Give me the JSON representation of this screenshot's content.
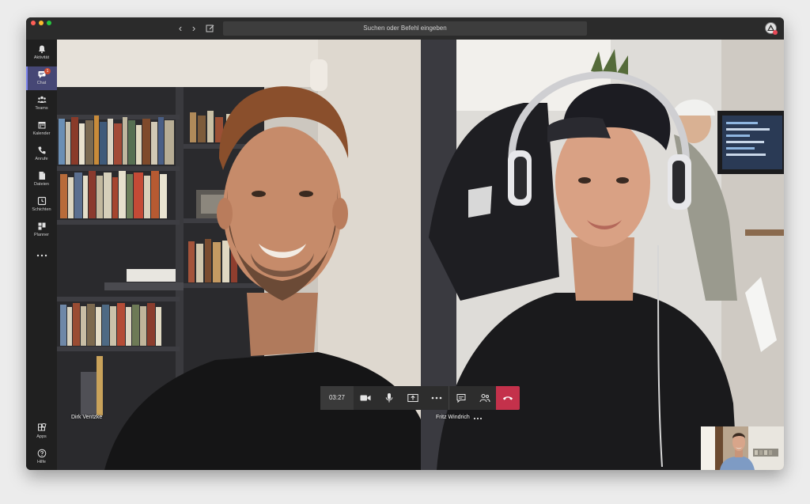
{
  "titlebar": {
    "search_placeholder": "Suchen oder Befehl eingeben",
    "back_icon": "chevron-left-icon",
    "forward_icon": "chevron-right-icon",
    "compose_icon": "compose-icon"
  },
  "rail": {
    "items": [
      {
        "label": "Aktivität",
        "icon": "bell-icon"
      },
      {
        "label": "Chat",
        "icon": "chat-icon",
        "badge": "1",
        "active": true
      },
      {
        "label": "Teams",
        "icon": "teams-icon"
      },
      {
        "label": "Kalender",
        "icon": "calendar-icon"
      },
      {
        "label": "Anrufe",
        "icon": "phone-icon"
      },
      {
        "label": "Dateien",
        "icon": "file-icon"
      },
      {
        "label": "Schichten",
        "icon": "clock-icon"
      },
      {
        "label": "Planner",
        "icon": "planner-icon"
      }
    ],
    "more_icon": "ellipsis-icon",
    "bottom_items": [
      {
        "label": "Apps",
        "icon": "apps-icon"
      },
      {
        "label": "Hilfe",
        "icon": "help-icon"
      }
    ]
  },
  "call": {
    "participants": [
      {
        "name": "Dirk Ventzke"
      },
      {
        "name": "Fritz Windrich"
      }
    ],
    "controls": {
      "timer": "03:27",
      "buttons": [
        "camera-icon",
        "microphone-icon",
        "share-screen-icon",
        "more-icon",
        "chat-icon",
        "participants-icon",
        "hang-up-icon"
      ]
    }
  },
  "colors": {
    "rail_bg": "#202020",
    "active_item": "#464775",
    "accent": "#7b83eb",
    "hangup": "#c4314b",
    "badge": "#cc4a31"
  }
}
